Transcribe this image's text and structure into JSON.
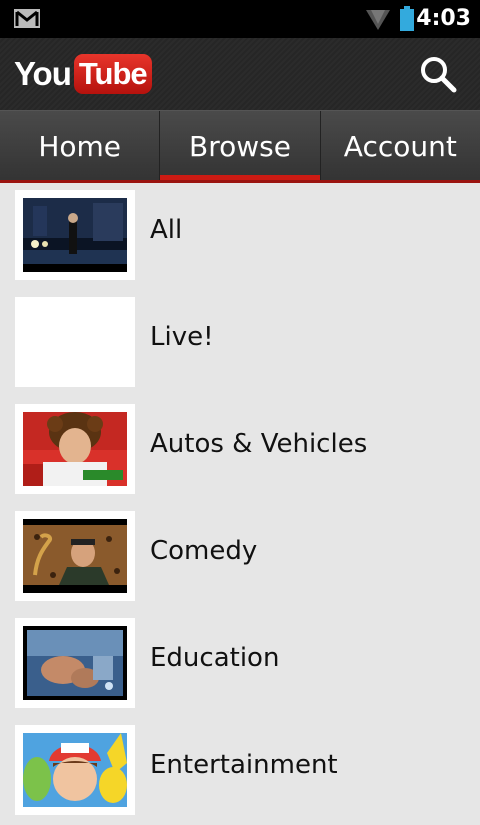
{
  "status_bar": {
    "time": "4:03",
    "icons": [
      "gmail-icon",
      "wifi-icon",
      "battery-icon"
    ],
    "battery_color": "#33aadd"
  },
  "app_bar": {
    "logo_you": "You",
    "logo_tube": "Tube",
    "brand_color": "#cc1a13",
    "search_icon": "search-icon"
  },
  "tabs": [
    {
      "label": "Home",
      "active": false
    },
    {
      "label": "Browse",
      "active": true
    },
    {
      "label": "Account",
      "active": false
    }
  ],
  "categories": [
    {
      "label": "All",
      "thumbnail": "night-street-scene"
    },
    {
      "label": "Live!",
      "thumbnail": "blank"
    },
    {
      "label": "Autos & Vehicles",
      "thumbnail": "curly-hair-rider"
    },
    {
      "label": "Comedy",
      "thumbnail": "man-with-prop"
    },
    {
      "label": "Education",
      "thumbnail": "blurry-news-clip"
    },
    {
      "label": "Entertainment",
      "thumbnail": "cartoon-characters"
    }
  ]
}
